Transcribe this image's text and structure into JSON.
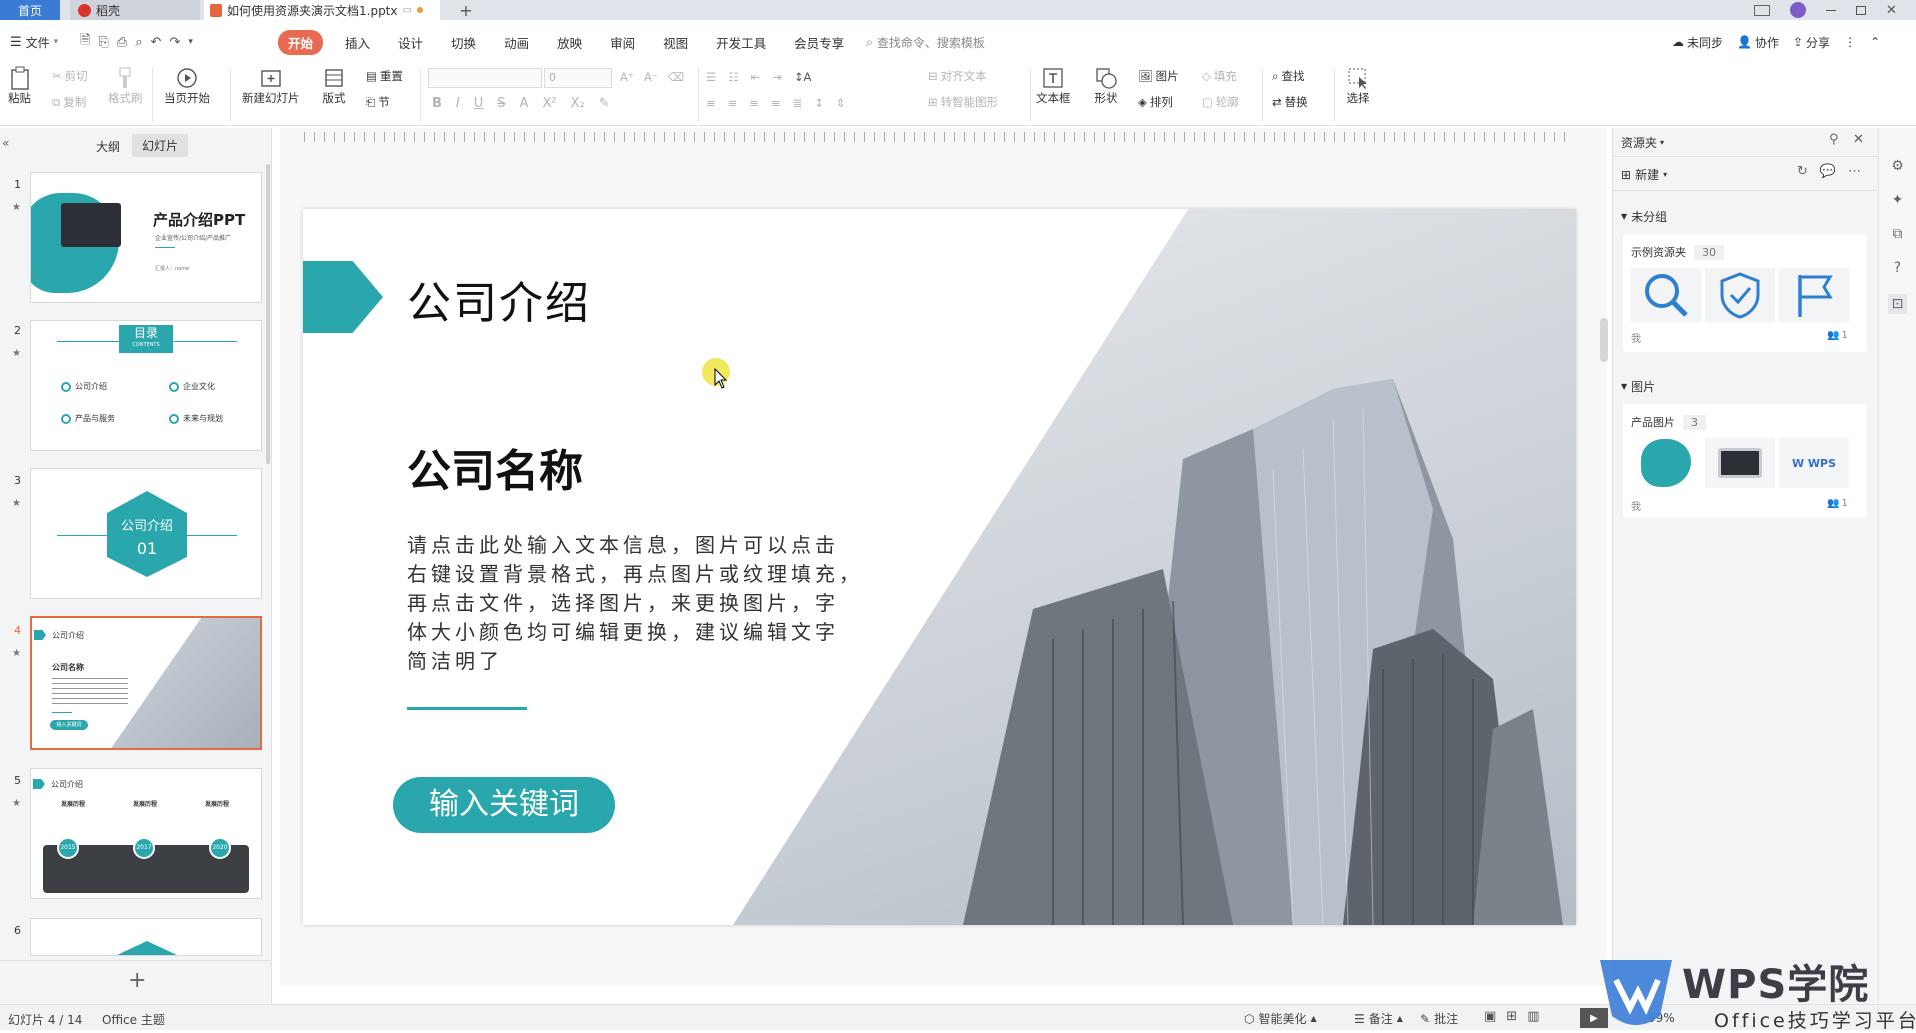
{
  "colors": {
    "accent": "#2aa7ad",
    "tab_active": "#3a7bd5",
    "menu_active": "#e86a52",
    "selection": "#e56c3c",
    "wps_purple": "#7b5cc9"
  },
  "titlebar": {
    "home_tab": "首页",
    "dao_tab": "稻壳",
    "doc_tab": "如何使用资源夹演示文档1.pptx"
  },
  "menubar": {
    "file": "文件",
    "tabs": [
      "开始",
      "插入",
      "设计",
      "切换",
      "动画",
      "放映",
      "审阅",
      "视图",
      "开发工具",
      "会员专享"
    ],
    "active_tab": "开始",
    "search_placeholder": "查找命令、搜索模板",
    "sync": "未同步",
    "collab": "协作",
    "share": "分享"
  },
  "ribbon": {
    "paste": "粘贴",
    "cut": "剪切",
    "copy": "复制",
    "format_painter": "格式刷",
    "from_current": "当页开始",
    "new_slide": "新建幻灯片",
    "layout": "版式",
    "reset": "重置",
    "section": "节",
    "font_size": "0",
    "align_text": "对齐文本",
    "convert_smart": "转智能图形",
    "textbox": "文本框",
    "shape": "形状",
    "picture": "图片",
    "fill": "填充",
    "arrange": "排列",
    "outline": "轮廓",
    "find": "查找",
    "replace": "替换",
    "select": "选择"
  },
  "leftpanel": {
    "tab_outline": "大纲",
    "tab_slides": "幻灯片",
    "selected_index": 4,
    "add_button": "+",
    "thumbs": [
      {
        "num": "1",
        "title": "产品介绍PPT",
        "subtitle": "企业宣传/公司介绍/产品推广",
        "small": "汇报人：name"
      },
      {
        "num": "2",
        "title": "目录",
        "sub": "CONTENTS",
        "items": [
          "公司介绍",
          "企业文化",
          "产品与服务",
          "未来与规划"
        ]
      },
      {
        "num": "3",
        "line1": "公司介绍",
        "line2": "01"
      },
      {
        "num": "4",
        "header": "公司介绍",
        "title": "公司名称",
        "button": "输入关键词"
      },
      {
        "num": "5",
        "header": "公司介绍",
        "cols": [
          "发展历程",
          "发展历程",
          "发展历程"
        ],
        "years": [
          "2015",
          "2017",
          "2020"
        ]
      },
      {
        "num": "6"
      }
    ]
  },
  "slide": {
    "header": "公司介绍",
    "company": "公司名称",
    "body_lines": [
      "请点击此处输入文本信息，图片可以点击",
      "右键设置背景格式，再点图片或纹理填充，",
      "再点击文件，选择图片，来更换图片，字",
      "体大小颜色均可编辑更换，建议编辑文字",
      "简洁明了"
    ],
    "button": "输入关键词"
  },
  "rightpanel": {
    "title": "资源夹",
    "new_button": "新建",
    "group_ungrouped": "未分组",
    "folder1_name": "示例资源夹",
    "folder1_count": "30",
    "folder1_owner": "我",
    "folder1_members": "1",
    "group_images": "图片",
    "folder2_name": "产品图片",
    "folder2_count": "3",
    "folder2_owner": "我",
    "folder2_members": "1"
  },
  "statusbar": {
    "slide_counter": "幻灯片 4 / 14",
    "theme": "Office 主题",
    "beautify": "智能美化",
    "notes": "备注",
    "comments": "批注",
    "zoom": "99%"
  },
  "watermark": {
    "brand": "WPS学院",
    "tagline": "Office技巧学习平台"
  }
}
